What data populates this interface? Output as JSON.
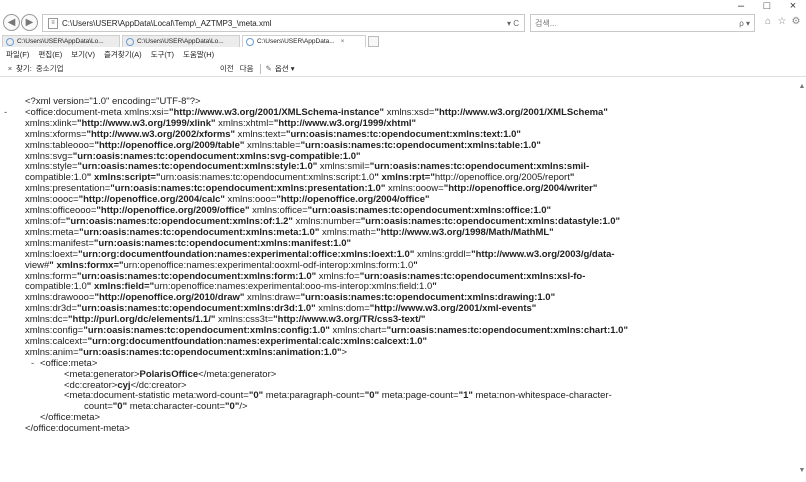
{
  "window": {
    "minimize": "–",
    "maximize": "□",
    "close": "×"
  },
  "address": {
    "url": "C:\\Users\\USER\\AppData\\Local\\Temp\\_AZTMP3_\\meta.xml",
    "actions": "▾ C"
  },
  "search": {
    "placeholder": "검색...",
    "button": "ρ ▾"
  },
  "toolbar_icons": [
    "home-icon",
    "star-icon",
    "gear-icon",
    "smiley-icon"
  ],
  "tabs": [
    {
      "title": "C:\\Users\\USER\\AppData\\Lo...",
      "active": false
    },
    {
      "title": "C:\\Users\\USER\\AppData\\Lo...",
      "active": false
    },
    {
      "title": "C:\\Users\\USER\\AppData...",
      "active": true,
      "close": "×"
    }
  ],
  "menu": [
    "파일(F)",
    "편집(E)",
    "보기(V)",
    "즐겨찾기(A)",
    "도구(T)",
    "도움말(H)"
  ],
  "find": {
    "close": "×",
    "label": "찾기:",
    "value": "중소기업",
    "prev": "이전",
    "next": "다음",
    "options": "옵션 ▾"
  },
  "xml": {
    "decl": "<?xml version=\"1.0\" encoding=\"UTF-8\"?>",
    "root_ns_line_1": "<office:document-meta xmlns:xsi=\"http://www.w3.org/2001/XMLSchema-instance\" xmlns:xsd=\"http://www.w3.org/2001/XMLSchema\"",
    "root_ns_block": [
      "xmlns:xlink=\"http://www.w3.org/1999/xlink\" xmlns:xhtml=\"http://www.w3.org/1999/xhtml\"",
      "xmlns:xforms=\"http://www.w3.org/2002/xforms\" xmlns:text=\"urn:oasis:names:tc:opendocument:xmlns:text:1.0\"",
      "xmlns:tableooo=\"http://openoffice.org/2009/table\" xmlns:table=\"urn:oasis:names:tc:opendocument:xmlns:table:1.0\"",
      "xmlns:svg=\"urn:oasis:names:tc:opendocument:xmlns:svg-compatible:1.0\"",
      "xmlns:style=\"urn:oasis:names:tc:opendocument:xmlns:style:1.0\" xmlns:smil=\"urn:oasis:names:tc:opendocument:xmlns:smil-",
      "compatible:1.0\" xmlns:script=\"urn:oasis:names:tc:opendocument:xmlns:script:1.0\" xmlns:rpt=\"http://openoffice.org/2005/report\"",
      "xmlns:presentation=\"urn:oasis:names:tc:opendocument:xmlns:presentation:1.0\" xmlns:ooow=\"http://openoffice.org/2004/writer\"",
      "xmlns:oooc=\"http://openoffice.org/2004/calc\" xmlns:ooo=\"http://openoffice.org/2004/office\"",
      "xmlns:officeooo=\"http://openoffice.org/2009/office\" xmlns:office=\"urn:oasis:names:tc:opendocument:xmlns:office:1.0\"",
      "xmlns:of=\"urn:oasis:names:tc:opendocument:xmlns:of:1.2\" xmlns:number=\"urn:oasis:names:tc:opendocument:xmlns:datastyle:1.0\"",
      "xmlns:meta=\"urn:oasis:names:tc:opendocument:xmlns:meta:1.0\" xmlns:math=\"http://www.w3.org/1998/Math/MathML\"",
      "xmlns:manifest=\"urn:oasis:names:tc:opendocument:xmlns:manifest:1.0\"",
      "xmlns:loext=\"urn:org:documentfoundation:names:experimental:office:xmlns:loext:1.0\" xmlns:grddl=\"http://www.w3.org/2003/g/data-",
      "view#\" xmlns:formx=\"urn:openoffice:names:experimental:ooxml-odf-interop:xmlns:form:1.0\"",
      "xmlns:form=\"urn:oasis:names:tc:opendocument:xmlns:form:1.0\" xmlns:fo=\"urn:oasis:names:tc:opendocument:xmlns:xsl-fo-",
      "compatible:1.0\" xmlns:field=\"urn:openoffice:names:experimental:ooo-ms-interop:xmlns:field:1.0\"",
      "xmlns:drawooo=\"http://openoffice.org/2010/draw\" xmlns:draw=\"urn:oasis:names:tc:opendocument:xmlns:drawing:1.0\"",
      "xmlns:dr3d=\"urn:oasis:names:tc:opendocument:xmlns:dr3d:1.0\" xmlns:dom=\"http://www.w3.org/2001/xml-events\"",
      "xmlns:dc=\"http://purl.org/dc/elements/1.1/\" xmlns:css3t=\"http://www.w3.org/TR/css3-text/\"",
      "xmlns:config=\"urn:oasis:names:tc:opendocument:xmlns:config:1.0\" xmlns:chart=\"urn:oasis:names:tc:opendocument:xmlns:chart:1.0\"",
      "xmlns:calcext=\"urn:org:documentfoundation:names:experimental:calc:xmlns:calcext:1.0\"",
      "xmlns:anim=\"urn:oasis:names:tc:opendocument:xmlns:animation:1.0\">"
    ],
    "meta_open": "<office:meta>",
    "generator_line": "<meta:generator>PolarisOffice</meta:generator>",
    "creator_line": "<dc:creator>cyj</dc:creator>",
    "statistic_line_1": "<meta:document-statistic meta:word-count=\"0\" meta:paragraph-count=\"0\" meta:page-count=\"1\" meta:non-whitespace-character-",
    "statistic_line_2": "count=\"0\" meta:character-count=\"0\"/>",
    "meta_close": "</office:meta>",
    "root_close": "</office:document-meta>",
    "collapse_marker": "-"
  },
  "scrollbar": {
    "up": "▲",
    "down": "▼"
  }
}
